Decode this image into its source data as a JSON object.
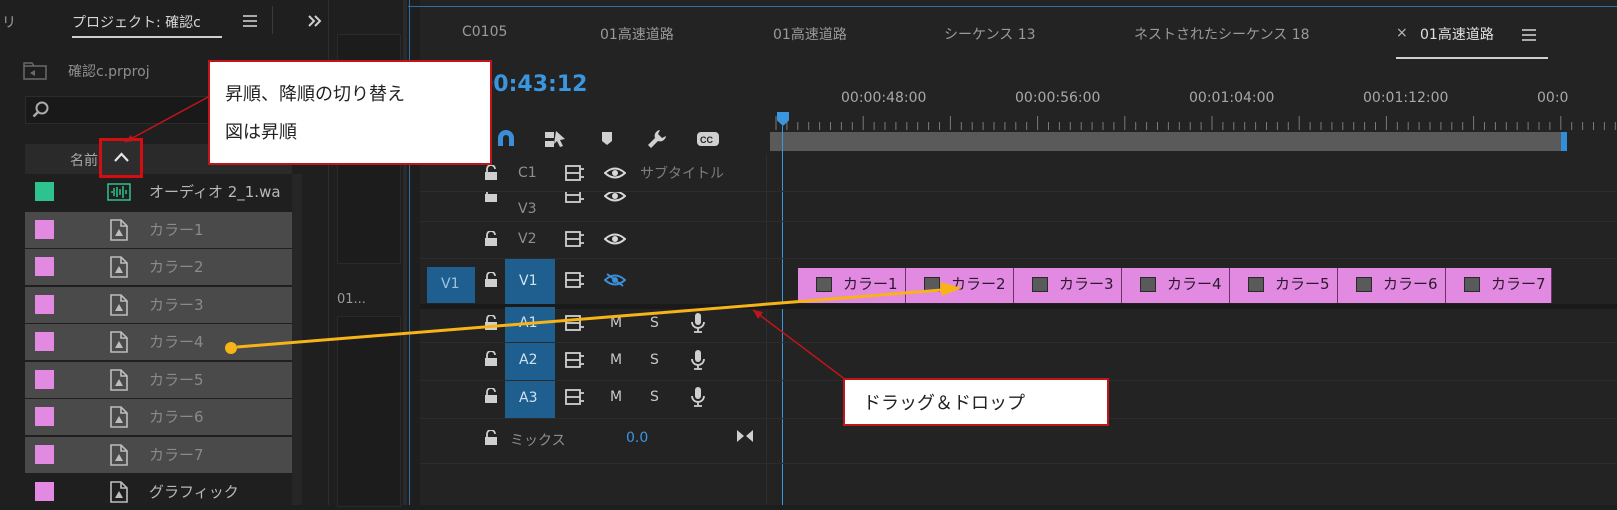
{
  "project": {
    "prev_tab_label": "リ",
    "title": "プロジェクト: 確認c",
    "file_name": "確認c.prproj",
    "column_name": "名前",
    "items": [
      {
        "name": "オーディオ 2_1.wa",
        "color": "#2ec28e",
        "type": "audio",
        "selected": false
      },
      {
        "name": "カラー1",
        "color": "#e28ae2",
        "type": "matte",
        "selected": true
      },
      {
        "name": "カラー2",
        "color": "#e28ae2",
        "type": "matte",
        "selected": true
      },
      {
        "name": "カラー3",
        "color": "#e28ae2",
        "type": "matte",
        "selected": true
      },
      {
        "name": "カラー4",
        "color": "#e28ae2",
        "type": "matte",
        "selected": true
      },
      {
        "name": "カラー5",
        "color": "#e28ae2",
        "type": "matte",
        "selected": true
      },
      {
        "name": "カラー6",
        "color": "#e28ae2",
        "type": "matte",
        "selected": true
      },
      {
        "name": "カラー7",
        "color": "#e28ae2",
        "type": "matte",
        "selected": true
      },
      {
        "name": "グラフィック",
        "color": "#e28ae2",
        "type": "graphic",
        "selected": false
      }
    ]
  },
  "middle_panel": {
    "more_label": "...",
    "label": "01..."
  },
  "timeline": {
    "tabs": [
      "C0105",
      "01高速道路",
      "01高速道路",
      "シーケンス 13",
      "ネストされたシーケンス 18",
      "01高速道路"
    ],
    "active_tab_close": "×",
    "timecode": "00:43:12",
    "ruler_labels": [
      "00:00:48:00",
      "00:00:56:00",
      "00:01:04:00",
      "00:01:12:00",
      "00:0"
    ],
    "tracks": {
      "c1": "C1",
      "c1_name": "サブタイトル",
      "v3": "V3",
      "v2": "V2",
      "v1_source": "V1",
      "v1": "V1",
      "a1": "A1",
      "a2": "A2",
      "a3": "A3",
      "mute": "M",
      "solo": "S",
      "mix_label": "ミックス",
      "mix_value": "0.0"
    },
    "clips": [
      "カラー1",
      "カラー2",
      "カラー3",
      "カラー4",
      "カラー5",
      "カラー6",
      "カラー7"
    ],
    "clip_color": "#e28ae2"
  },
  "callouts": {
    "sort": {
      "line1": "昇順、降順の切り替え",
      "line2": "図は昇順"
    },
    "drag": "ドラッグ＆ドロップ"
  },
  "colors": {
    "accent_blue": "#2f8fd8",
    "track_blue": "#1f5f8f",
    "annotation_red": "#c0151b",
    "arrow_yellow": "#f6b417"
  }
}
